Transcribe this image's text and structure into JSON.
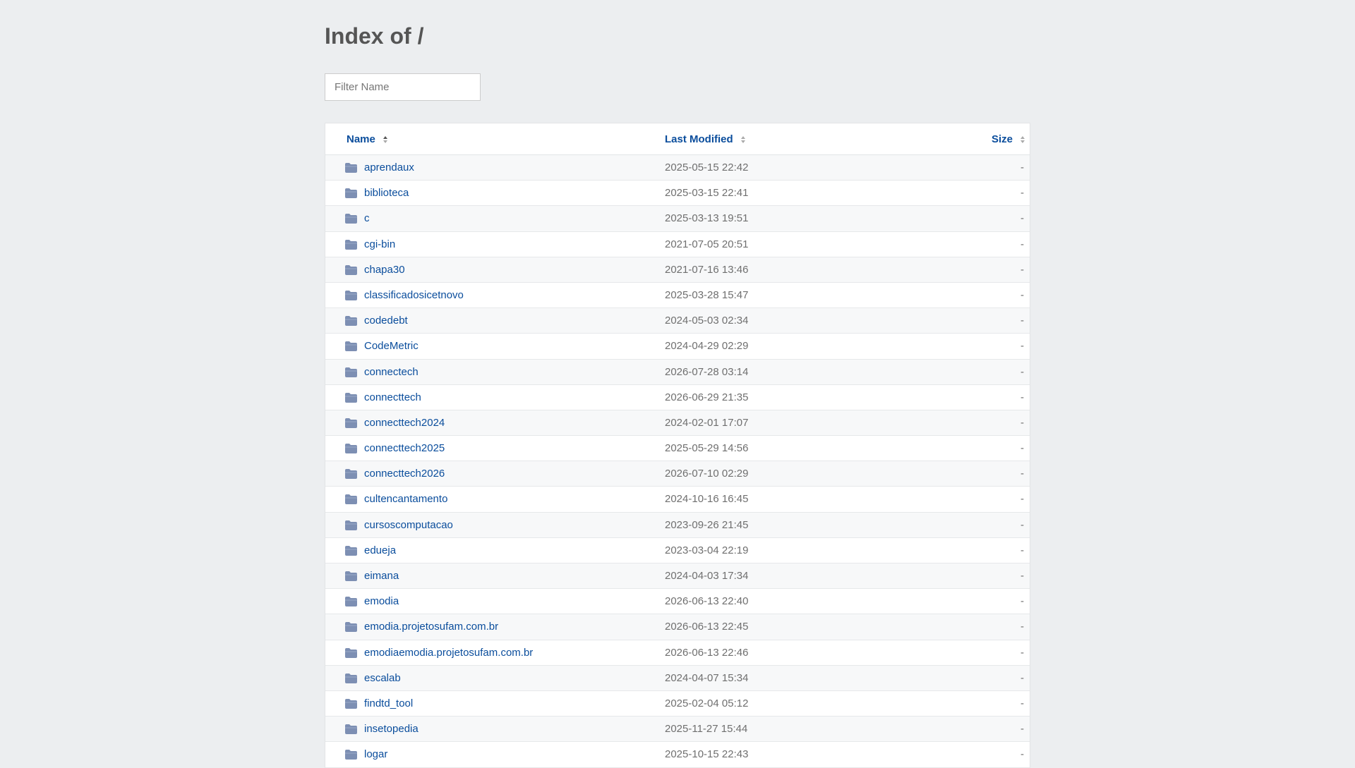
{
  "page": {
    "title": "Index of /",
    "filter_placeholder": "Filter Name"
  },
  "table": {
    "headers": {
      "name": "Name",
      "last_modified": "Last Modified",
      "size": "Size"
    },
    "rows": [
      {
        "name": "aprendaux",
        "modified": "2025-05-15 22:42",
        "size": "-"
      },
      {
        "name": "biblioteca",
        "modified": "2025-03-15 22:41",
        "size": "-"
      },
      {
        "name": "c",
        "modified": "2025-03-13 19:51",
        "size": "-"
      },
      {
        "name": "cgi-bin",
        "modified": "2021-07-05 20:51",
        "size": "-"
      },
      {
        "name": "chapa30",
        "modified": "2021-07-16 13:46",
        "size": "-"
      },
      {
        "name": "classificadosicetnovo",
        "modified": "2025-03-28 15:47",
        "size": "-"
      },
      {
        "name": "codedebt",
        "modified": "2024-05-03 02:34",
        "size": "-"
      },
      {
        "name": "CodeMetric",
        "modified": "2024-04-29 02:29",
        "size": "-"
      },
      {
        "name": "connectech",
        "modified": "2026-07-28 03:14",
        "size": "-"
      },
      {
        "name": "connecttech",
        "modified": "2026-06-29 21:35",
        "size": "-"
      },
      {
        "name": "connecttech2024",
        "modified": "2024-02-01 17:07",
        "size": "-"
      },
      {
        "name": "connecttech2025",
        "modified": "2025-05-29 14:56",
        "size": "-"
      },
      {
        "name": "connecttech2026",
        "modified": "2026-07-10 02:29",
        "size": "-"
      },
      {
        "name": "cultencantamento",
        "modified": "2024-10-16 16:45",
        "size": "-"
      },
      {
        "name": "cursoscomputacao",
        "modified": "2023-09-26 21:45",
        "size": "-"
      },
      {
        "name": "edueja",
        "modified": "2023-03-04 22:19",
        "size": "-"
      },
      {
        "name": "eimana",
        "modified": "2024-04-03 17:34",
        "size": "-"
      },
      {
        "name": "emodia",
        "modified": "2026-06-13 22:40",
        "size": "-"
      },
      {
        "name": "emodia.projetosufam.com.br",
        "modified": "2026-06-13 22:45",
        "size": "-"
      },
      {
        "name": "emodiaemodia.projetosufam.com.br",
        "modified": "2026-06-13 22:46",
        "size": "-"
      },
      {
        "name": "escalab",
        "modified": "2024-04-07 15:34",
        "size": "-"
      },
      {
        "name": "findtd_tool",
        "modified": "2025-02-04 05:12",
        "size": "-"
      },
      {
        "name": "insetopedia",
        "modified": "2025-11-27 15:44",
        "size": "-"
      },
      {
        "name": "logar",
        "modified": "2025-10-15 22:43",
        "size": "-"
      }
    ]
  },
  "icons": {
    "folder": "folder-icon",
    "sort": "sort-icon"
  },
  "colors": {
    "link": "#0a4d9c",
    "folder": "#7d8fb3",
    "background": "#eceef0"
  }
}
